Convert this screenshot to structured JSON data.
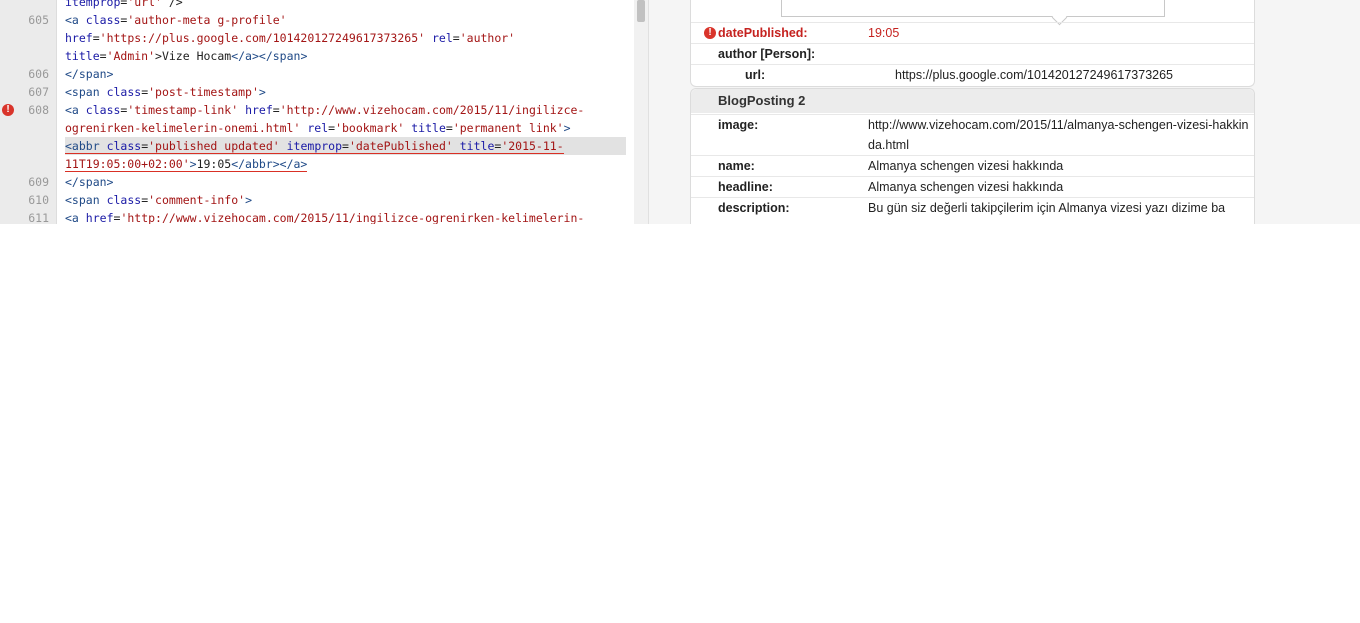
{
  "code": {
    "lines": [
      {
        "num": "",
        "segments": [
          [
            "a",
            "itemprop"
          ],
          [
            "p",
            "="
          ],
          [
            "v",
            "'url'"
          ],
          [
            "p",
            " />"
          ]
        ]
      },
      {
        "num": "605",
        "segments": [
          [
            "t",
            "<a"
          ],
          [
            "p",
            " "
          ],
          [
            "a",
            "class"
          ],
          [
            "p",
            "="
          ],
          [
            "v",
            "'author-meta g-profile'"
          ]
        ]
      },
      {
        "num": "",
        "segments": [
          [
            "a",
            "href"
          ],
          [
            "p",
            "="
          ],
          [
            "v",
            "'https://plus.google.com/101420127249617373265'"
          ],
          [
            "p",
            " "
          ],
          [
            "a",
            "rel"
          ],
          [
            "p",
            "="
          ],
          [
            "v",
            "'author'"
          ]
        ]
      },
      {
        "num": "",
        "segments": [
          [
            "a",
            "title"
          ],
          [
            "p",
            "="
          ],
          [
            "v",
            "'Admin'"
          ],
          [
            "p",
            ">Vize Hocam"
          ],
          [
            "t",
            "</a></span>"
          ]
        ]
      },
      {
        "num": "606",
        "segments": [
          [
            "t",
            "</span>"
          ]
        ]
      },
      {
        "num": "607",
        "segments": [
          [
            "t",
            "<span"
          ],
          [
            "p",
            " "
          ],
          [
            "a",
            "class"
          ],
          [
            "p",
            "="
          ],
          [
            "v",
            "'post-timestamp'"
          ],
          [
            "t",
            ">"
          ]
        ]
      },
      {
        "num": "608",
        "error": true,
        "segments": [
          [
            "t",
            "<a"
          ],
          [
            "p",
            " "
          ],
          [
            "a",
            "class"
          ],
          [
            "p",
            "="
          ],
          [
            "v",
            "'timestamp-link'"
          ],
          [
            "p",
            " "
          ],
          [
            "a",
            "href"
          ],
          [
            "p",
            "="
          ],
          [
            "v",
            "'http://www.vizehocam.com/2015/11/ingilizce-"
          ]
        ]
      },
      {
        "num": "",
        "segments": [
          [
            "v",
            "ogrenirken-kelimelerin-onemi.html'"
          ],
          [
            "p",
            " "
          ],
          [
            "a",
            "rel"
          ],
          [
            "p",
            "="
          ],
          [
            "v",
            "'bookmark'"
          ],
          [
            "p",
            " "
          ],
          [
            "a",
            "title"
          ],
          [
            "p",
            "="
          ],
          [
            "v",
            "'permanent link'"
          ],
          [
            "t",
            ">"
          ]
        ]
      },
      {
        "num": "",
        "highlight": true,
        "underline": true,
        "segments": [
          [
            "t",
            "<abbr"
          ],
          [
            "p",
            " "
          ],
          [
            "a",
            "class"
          ],
          [
            "p",
            "="
          ],
          [
            "v",
            "'published updated'"
          ],
          [
            "p",
            " "
          ],
          [
            "a",
            "itemprop"
          ],
          [
            "p",
            "="
          ],
          [
            "v",
            "'datePublished'"
          ],
          [
            "p",
            " "
          ],
          [
            "a",
            "title"
          ],
          [
            "p",
            "="
          ],
          [
            "v",
            "'2015-11-"
          ]
        ]
      },
      {
        "num": "",
        "underline": true,
        "segments": [
          [
            "v",
            "11T19:05:00+02:00'"
          ],
          [
            "t",
            ">"
          ],
          [
            "p",
            "19:05"
          ],
          [
            "t",
            "</abbr>"
          ],
          [
            "t",
            "</a>"
          ]
        ]
      },
      {
        "num": "609",
        "segments": [
          [
            "t",
            "</span>"
          ]
        ]
      },
      {
        "num": "610",
        "segments": [
          [
            "t",
            "<span"
          ],
          [
            "p",
            " "
          ],
          [
            "a",
            "class"
          ],
          [
            "p",
            "="
          ],
          [
            "v",
            "'comment-info'"
          ],
          [
            "t",
            ">"
          ]
        ]
      },
      {
        "num": "611",
        "segments": [
          [
            "t",
            "<a"
          ],
          [
            "p",
            " "
          ],
          [
            "a",
            "href"
          ],
          [
            "p",
            "="
          ],
          [
            "v",
            "'http://www.vizehocam.com/2015/11/ingilizce-ogrenirken-kelimelerin-"
          ]
        ]
      }
    ]
  },
  "results": {
    "tooltip_text": "",
    "date_published": {
      "label": "datePublished:",
      "value": "19:05"
    },
    "author": {
      "label": "author [Person]:"
    },
    "author_url": {
      "label": "url:",
      "value": "https://plus.google.com/101420127249617373265"
    },
    "section_title": "BlogPosting 2",
    "image": {
      "label": "image:",
      "value": "http://www.vizehocam.com/2015/11/almanya-schengen-vizesi-hakkinda.html"
    },
    "name": {
      "label": "name:",
      "value": "Almanya schengen vizesi hakkında"
    },
    "headline": {
      "label": "headline:",
      "value": "Almanya schengen vizesi hakkında"
    },
    "description": {
      "label": "description:",
      "value": "Bu gün siz değerli takipçilerim için Almanya vizesi yazı dizime ba"
    }
  },
  "icons": {
    "error": "error-icon"
  },
  "colors": {
    "error": "#c5221f",
    "tag": "#204a87",
    "attr": "#1a1aa6",
    "value": "#a31515"
  }
}
